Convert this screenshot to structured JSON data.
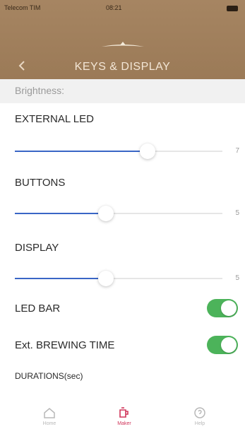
{
  "status_bar": {
    "carrier": "Telecom TIM",
    "time": "08:21"
  },
  "header": {
    "title": "KEYS & DISPLAY",
    "back_icon": "chevron-left-icon"
  },
  "section": {
    "label": "Brightness:"
  },
  "sliders": [
    {
      "label": "EXTERNAL LED",
      "value": "7",
      "fraction": 0.64
    },
    {
      "label": "BUTTONS",
      "value": "5",
      "fraction": 0.44
    },
    {
      "label": "DISPLAY",
      "value": "5",
      "fraction": 0.44
    }
  ],
  "toggles": [
    {
      "label": "LED BAR",
      "on": true
    },
    {
      "label": "Ext. BREWING TIME",
      "on": true
    }
  ],
  "durations_label": "DURATIONS(sec)",
  "tabbar": [
    {
      "label": "Home",
      "icon": "home-icon",
      "active": false
    },
    {
      "label": "Maker",
      "icon": "coffee-maker-icon",
      "active": true
    },
    {
      "label": "Help",
      "icon": "help-icon",
      "active": false
    }
  ],
  "colors": {
    "header": "#9b7a57",
    "slider_fill": "#3a66c6",
    "toggle_on": "#4cb35a",
    "tab_active": "#d0355a",
    "tab_inactive": "#b8b8b8"
  }
}
